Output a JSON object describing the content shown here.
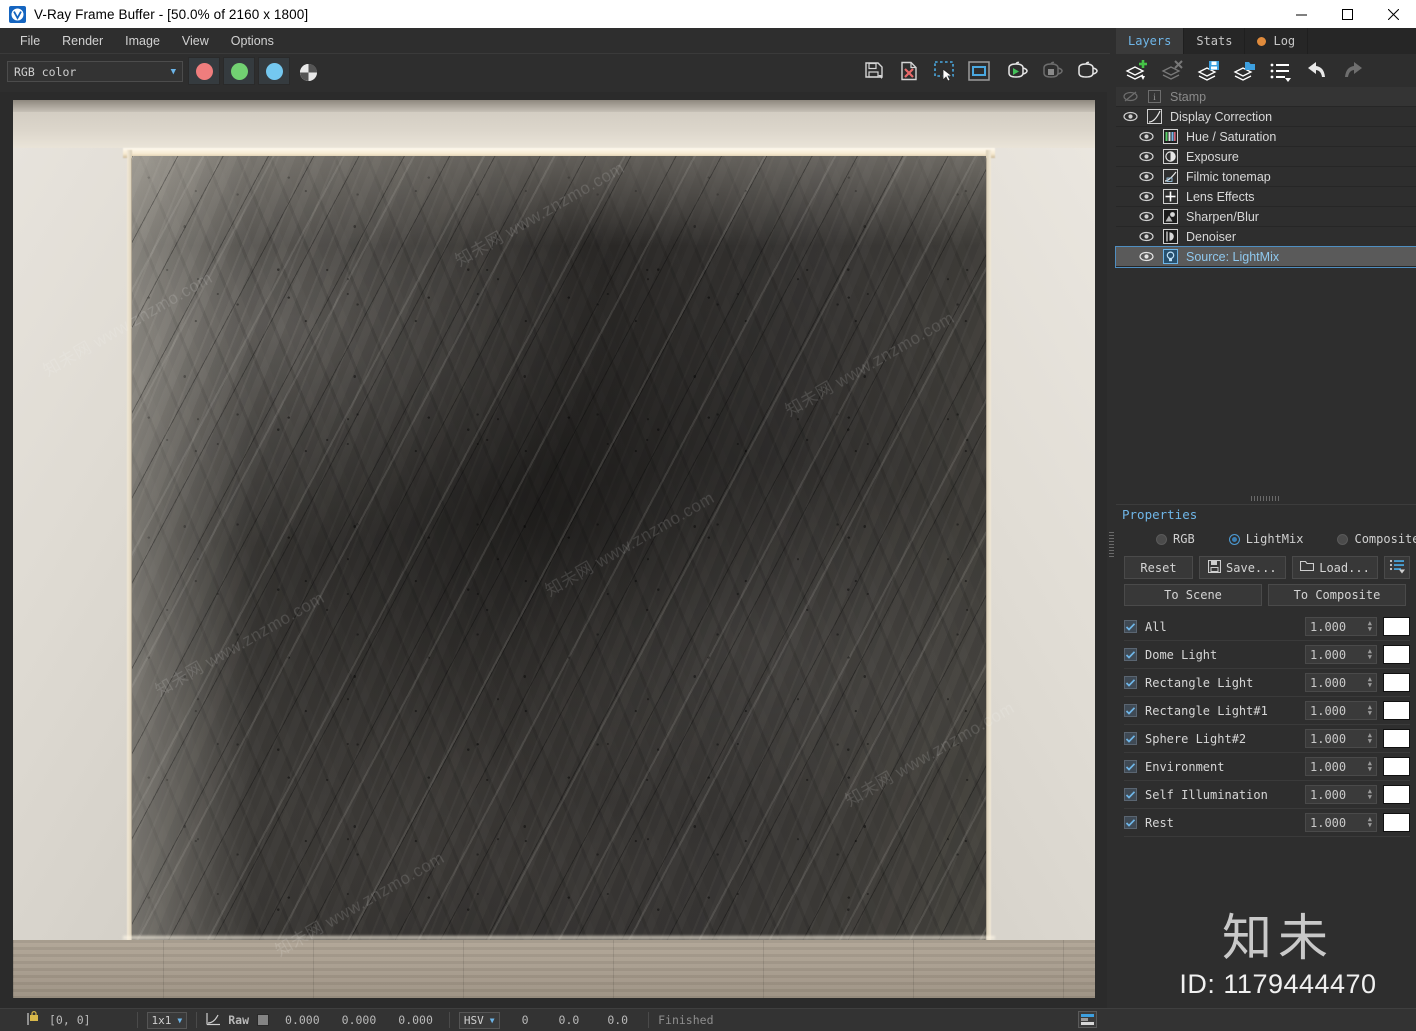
{
  "window": {
    "title": "V-Ray Frame Buffer - [50.0% of 2160 x 1800]",
    "logo_icon": "vray-logo-icon",
    "minimize_label": "–",
    "maximize_label": "□",
    "close_label": "✕"
  },
  "menubar": {
    "items": [
      {
        "label": "File"
      },
      {
        "label": "Render"
      },
      {
        "label": "Image"
      },
      {
        "label": "View"
      },
      {
        "label": "Options"
      }
    ]
  },
  "toolbar": {
    "channel_select": {
      "value": "RGB color",
      "arrow": "▼"
    },
    "channel_buttons": [
      {
        "name": "red-channel-button",
        "color": "#ef7d7d"
      },
      {
        "name": "green-channel-button",
        "color": "#72d172"
      },
      {
        "name": "blue-channel-button",
        "color": "#74c8f0"
      }
    ],
    "alpha_button": {
      "name": "alpha-channel-button"
    },
    "right_icons": [
      {
        "name": "save-image-icon"
      },
      {
        "name": "clear-image-icon"
      },
      {
        "name": "region-select-icon"
      },
      {
        "name": "show-render-region-icon"
      },
      {
        "name": "start-render-icon"
      },
      {
        "name": "stop-render-icon"
      },
      {
        "name": "render-last-icon"
      }
    ]
  },
  "panel": {
    "tabs": [
      {
        "label": "Layers",
        "active": true
      },
      {
        "label": "Stats",
        "active": false
      },
      {
        "label": "Log",
        "active": false,
        "dot": true
      }
    ],
    "layer_toolbar": [
      {
        "name": "add-layer-button"
      },
      {
        "name": "delete-layer-button"
      },
      {
        "name": "save-layers-button"
      },
      {
        "name": "load-layers-button"
      },
      {
        "name": "layer-presets-button"
      },
      {
        "name": "undo-button"
      },
      {
        "name": "redo-button"
      }
    ],
    "layers": [
      {
        "label": "Stamp",
        "icon": "stamp-icon",
        "visible": false,
        "selected": false,
        "indent": 0
      },
      {
        "label": "Display Correction",
        "icon": "curve-icon",
        "visible": true,
        "selected": false,
        "indent": 0
      },
      {
        "label": "Hue / Saturation",
        "icon": "hue-saturation-icon",
        "visible": true,
        "selected": false,
        "indent": 1
      },
      {
        "label": "Exposure",
        "icon": "exposure-icon",
        "visible": true,
        "selected": false,
        "indent": 1
      },
      {
        "label": "Filmic tonemap",
        "icon": "filmic-tonemap-icon",
        "visible": true,
        "selected": false,
        "indent": 1
      },
      {
        "label": "Lens Effects",
        "icon": "lens-effects-icon",
        "visible": true,
        "selected": false,
        "indent": 1
      },
      {
        "label": "Sharpen/Blur",
        "icon": "sharpen-blur-icon",
        "visible": true,
        "selected": false,
        "indent": 1
      },
      {
        "label": "Denoiser",
        "icon": "denoiser-icon",
        "visible": true,
        "selected": false,
        "indent": 1
      },
      {
        "label": "Source: LightMix",
        "icon": "lightmix-icon",
        "visible": true,
        "selected": true,
        "indent": 1
      }
    ]
  },
  "properties": {
    "title": "Properties",
    "modes": [
      {
        "label": "RGB",
        "selected": false
      },
      {
        "label": "LightMix",
        "selected": true
      },
      {
        "label": "Composite",
        "selected": false
      }
    ],
    "buttons": {
      "reset": "Reset",
      "save": "Save...",
      "load": "Load...",
      "menu_icon": "list-menu-icon",
      "to_scene": "To Scene",
      "to_composite": "To Composite"
    },
    "lights": [
      {
        "name": "All",
        "checked": true,
        "value": "1.000",
        "color": "#ffffff"
      },
      {
        "name": "Dome Light",
        "checked": true,
        "value": "1.000",
        "color": "#ffffff"
      },
      {
        "name": "Rectangle Light",
        "checked": true,
        "value": "1.000",
        "color": "#ffffff"
      },
      {
        "name": "Rectangle Light#1",
        "checked": true,
        "value": "1.000",
        "color": "#ffffff"
      },
      {
        "name": "Sphere Light#2",
        "checked": true,
        "value": "1.000",
        "color": "#ffffff"
      },
      {
        "name": "Environment",
        "checked": true,
        "value": "1.000",
        "color": "#ffffff"
      },
      {
        "name": "Self Illumination",
        "checked": true,
        "value": "1.000",
        "color": "#ffffff"
      },
      {
        "name": "Rest",
        "checked": true,
        "value": "1.000",
        "color": "#ffffff"
      }
    ]
  },
  "statusbar": {
    "pin_icon": "pin-lock-icon",
    "coords": "[0, 0]",
    "sample_size": {
      "value": "1x1",
      "arrow": "▼"
    },
    "curve_icon": "curve-small-icon",
    "raw_label": "Raw",
    "color_values": [
      "0.000",
      "0.000",
      "0.000"
    ],
    "color_space": {
      "value": "HSV",
      "arrow": "▼"
    },
    "hsv_values": [
      "0",
      "0.0",
      "0.0"
    ],
    "state": "Finished",
    "panel_toggle_icon": "panel-toggle-icon"
  },
  "watermark": {
    "brand_cn": "知未",
    "id_text": "ID: 1179444470",
    "overlay_text": "知未网 www.znzmo.com"
  }
}
